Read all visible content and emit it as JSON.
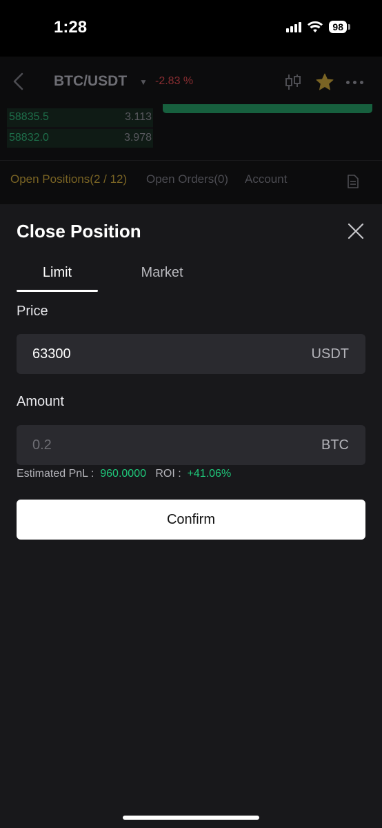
{
  "status_bar": {
    "time": "1:28",
    "battery": "98"
  },
  "header": {
    "pair": "BTC/USDT",
    "change": "-2.83 %"
  },
  "orderbook": [
    {
      "price": "58835.5",
      "qty": "3.113"
    },
    {
      "price": "58832.0",
      "qty": "3.978"
    }
  ],
  "bg_tabs": {
    "positions": "Open Positions(2 / 12)",
    "orders": "Open Orders(0)",
    "account": "Account"
  },
  "sheet": {
    "title": "Close Position",
    "tabs": [
      "Limit",
      "Market"
    ],
    "price_label": "Price",
    "price_value": "63300",
    "price_unit": "USDT",
    "amount_label": "Amount",
    "amount_placeholder": "0.2",
    "amount_unit": "BTC",
    "pnl_label": "Estimated PnL :",
    "pnl_value": "960.0000",
    "roi_label": "ROI :",
    "roi_value": "+41.06%",
    "confirm": "Confirm"
  },
  "colors": {
    "accent_green": "#1fc97b",
    "negative_red": "#8b2e32",
    "star": "#7a6424",
    "sheet_bg": "#18181b"
  },
  "icons": [
    "back-icon",
    "candlestick-icon",
    "star-icon",
    "more-icon",
    "document-icon",
    "close-icon",
    "wifi-icon",
    "signal-icon",
    "battery-icon"
  ]
}
